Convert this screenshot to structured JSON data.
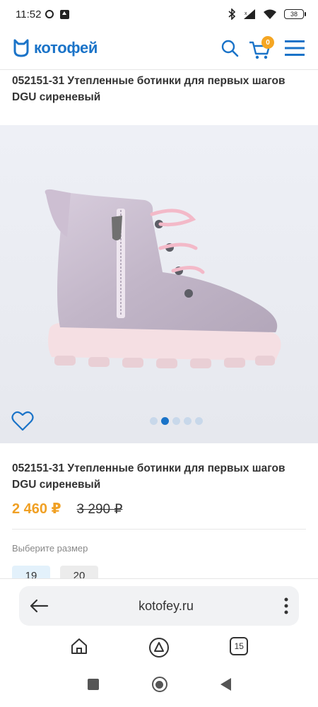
{
  "status": {
    "time": "11:52",
    "battery": "38"
  },
  "header": {
    "logo_text": "котофей",
    "cart_count": "0"
  },
  "product": {
    "title": "052151-31 Утепленные ботинки для первых шагов DGU сиреневый",
    "price": "2 460 ₽",
    "old_price": "3 290 ₽",
    "gallery": {
      "slides": 5,
      "active": 1
    }
  },
  "size_picker": {
    "label": "Выберите размер",
    "sizes": [
      "19",
      "20"
    ],
    "selected": "19"
  },
  "browser": {
    "url": "kotofey.ru",
    "tab_count": "15"
  },
  "colors": {
    "brand": "#1a73c8",
    "price": "#f0a024",
    "badge": "#f5a623"
  }
}
